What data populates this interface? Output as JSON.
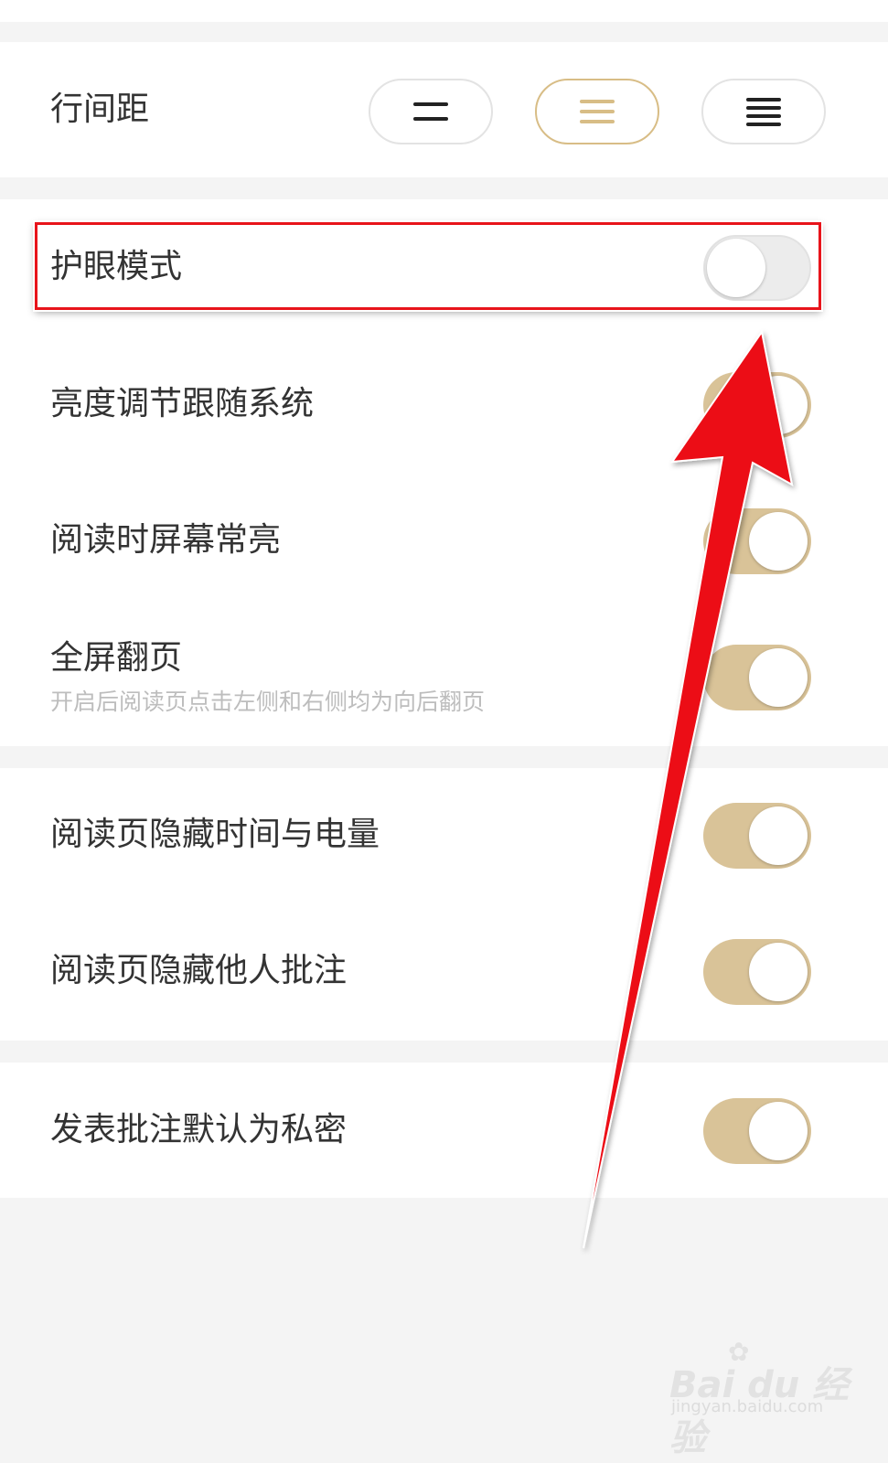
{
  "line_spacing": {
    "label": "行间距",
    "options": [
      {
        "icon": "spacing-small-icon",
        "bars": 2,
        "selected": false
      },
      {
        "icon": "spacing-medium-icon",
        "bars": 3,
        "selected": true
      },
      {
        "icon": "spacing-large-icon",
        "bars": 4,
        "selected": false
      }
    ]
  },
  "settings": {
    "eye_care": {
      "label": "护眼模式",
      "enabled": false
    },
    "brightness_follow_system": {
      "label": "亮度调节跟随系统",
      "enabled": true
    },
    "screen_always_on": {
      "label": "阅读时屏幕常亮",
      "enabled": true
    },
    "fullscreen_page_turn": {
      "label": "全屏翻页",
      "description": "开启后阅读页点击左侧和右侧均为向后翻页",
      "enabled": true
    },
    "hide_time_battery": {
      "label": "阅读页隐藏时间与电量",
      "enabled": true
    },
    "hide_others_notes": {
      "label": "阅读页隐藏他人批注",
      "enabled": true
    },
    "notes_private_default": {
      "label": "发表批注默认为私密",
      "enabled": true
    }
  },
  "colors": {
    "accent": "#d8bd86",
    "toggle_on": "#d9c398",
    "annotation_red": "#e8141b"
  },
  "watermark": {
    "brand": "Bai du 经验",
    "url": "jingyan.baidu.com"
  }
}
